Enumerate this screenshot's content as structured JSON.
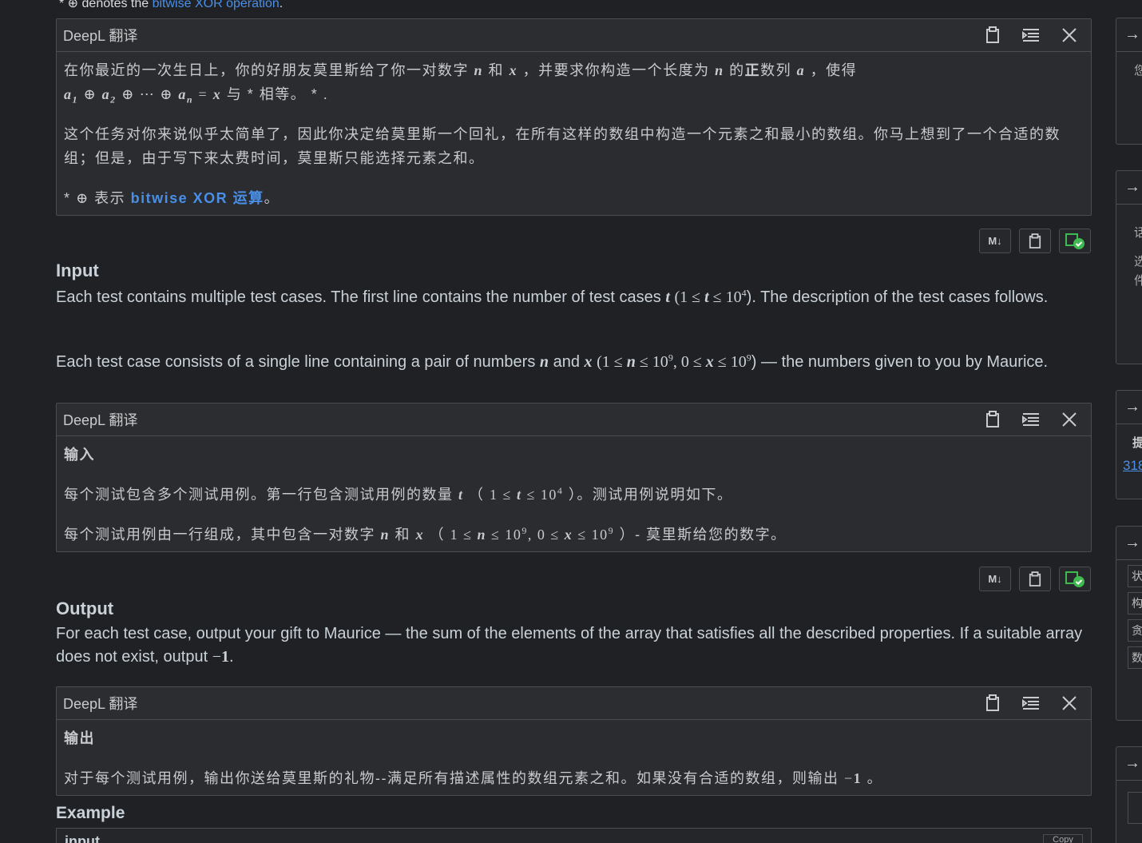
{
  "top_note": {
    "prefix": "* ⊕ denotes the ",
    "link": "bitwise XOR operation",
    "suffix": "."
  },
  "panel1": {
    "title": "DeepL 翻译",
    "line1_a": "在你最近的一次生日上，你的好朋友莫里斯给了你一对数字",
    "line1_b": "和",
    "line1_c": "，并要求你构造一个长度为",
    "line1_d": "的",
    "line1_e": "正",
    "line1_f": "数列",
    "line1_g": "，使得",
    "line2_a": "与",
    "line2_b": "相等。",
    "para2": "这个任务对你来说似乎太简单了，因此你决定给莫里斯一个回礼，在所有这样的数组中构造一个元素之和最小的数组。你马上想到了一个合适的数组；但是，由于写下来太费时间，莫里斯只能选择元素之和。",
    "note_a": "表示",
    "note_link": "bitwise XOR 运算",
    "note_end": "。"
  },
  "input": {
    "title": "Input",
    "p1_a": "Each test contains multiple test cases. The first line contains the number of test cases ",
    "p1_b": "). The description of the test cases follows.",
    "p2_a": "Each test case consists of a single line containing a pair of numbers ",
    "p2_b": " and ",
    "p2_c": ") — the numbers given to you by Maurice."
  },
  "panel2": {
    "title": "DeepL 翻译",
    "heading": "输入",
    "p1_a": "每个测试包含多个测试用例。第一行包含测试用例的数量",
    "p1_b": "）。测试用例说明如下。",
    "p2_a": "每个测试用例由一行组成，其中包含一对数字",
    "p2_b": "和",
    "p2_c": "）- 莫里斯给您的数字。"
  },
  "output": {
    "title": "Output",
    "p1_a": "For each test case, output your gift to Maurice — the sum of the elements of the array that satisfies all the described properties. If a suitable array does not exist, output ",
    "p1_b": "."
  },
  "panel3": {
    "title": "DeepL 翻译",
    "heading": "输出",
    "p1_a": "对于每个测试用例，输出你送给莫里斯的礼物--满足所有描述属性的数组元素之和。如果没有合适的数组，则输出",
    "p1_b": "。"
  },
  "example": {
    "title": "Example",
    "input_label": "input",
    "copy_label": "Copy"
  },
  "md_button": "M↓",
  "right_column": {
    "card1_text": "您",
    "card2_texts": [
      "话",
      "选",
      "件"
    ],
    "card3_text": "提",
    "card3_link": "318",
    "card4_boxes": [
      "状",
      "构",
      "贪",
      "数"
    ]
  }
}
